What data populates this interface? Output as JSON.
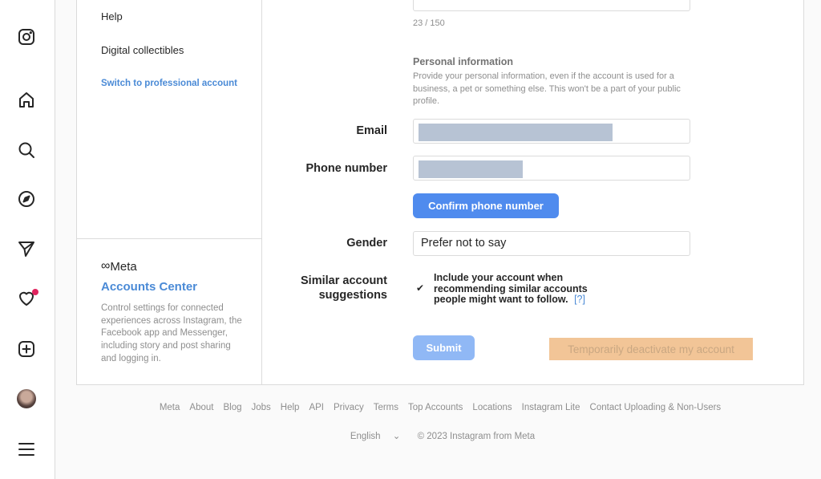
{
  "nav": {
    "items": [
      {
        "icon": "instagram-logo-icon"
      },
      {
        "icon": "home-icon"
      },
      {
        "icon": "search-icon"
      },
      {
        "icon": "explore-compass-icon"
      },
      {
        "icon": "messages-send-icon"
      },
      {
        "icon": "notifications-heart-icon",
        "badge_color": "#e0245e"
      },
      {
        "icon": "create-plus-icon"
      },
      {
        "icon": "profile-avatar"
      },
      {
        "icon": "menu-hamburger-icon"
      }
    ]
  },
  "sidebar": {
    "items": [
      {
        "label": "Help"
      },
      {
        "label": "Digital collectibles"
      },
      {
        "label": "Switch to professional account"
      }
    ],
    "meta_logo": "Meta",
    "accounts_center_title": "Accounts Center",
    "accounts_center_desc": "Control settings for connected experiences across Instagram, the Facebook app and Messenger, including story and post sharing and logging in."
  },
  "form": {
    "bio_counter": "23 / 150",
    "personal_info_title": "Personal information",
    "personal_info_desc": "Provide your personal information, even if the account is used for a business, a pet or something else. This won't be a part of your public profile.",
    "email_label": "Email",
    "phone_label": "Phone number",
    "confirm_phone_button": "Confirm phone number",
    "gender_label": "Gender",
    "gender_value": "Prefer not to say",
    "similar_label": "Similar account suggestions",
    "similar_checked": true,
    "similar_text": "Include your account when recommending similar accounts people might want to follow.",
    "similar_help": "[?]",
    "submit_button": "Submit",
    "deactivate_button": "Temporarily deactivate my account",
    "accent_color": "#4f8bee"
  },
  "footer": {
    "links": [
      "Meta",
      "About",
      "Blog",
      "Jobs",
      "Help",
      "API",
      "Privacy",
      "Terms",
      "Top Accounts",
      "Locations",
      "Instagram Lite",
      "Contact Uploading & Non-Users"
    ],
    "language": "English",
    "copyright": "© 2023 Instagram from Meta"
  }
}
